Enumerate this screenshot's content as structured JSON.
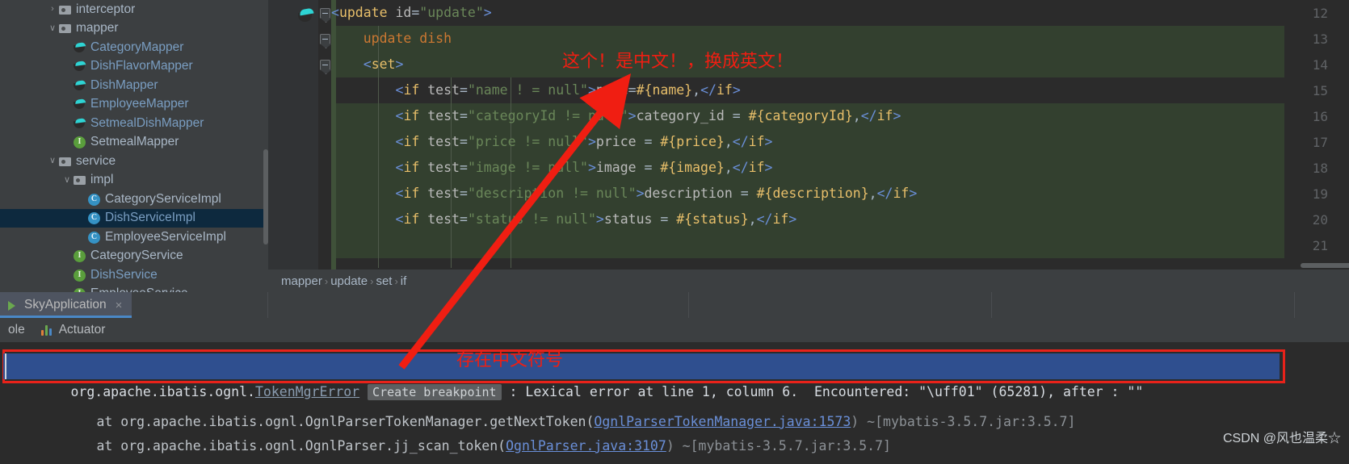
{
  "project_tree": {
    "items": [
      {
        "label": "interceptor",
        "icon": "folder-icon",
        "indent": 0,
        "arrow": "›",
        "selected": false,
        "blue": false
      },
      {
        "label": "mapper",
        "icon": "folder-icon",
        "indent": 0,
        "arrow": "∨",
        "selected": false,
        "blue": false
      },
      {
        "label": "CategoryMapper",
        "icon": "mybatis-icon",
        "indent": 1,
        "arrow": "",
        "selected": false,
        "blue": true
      },
      {
        "label": "DishFlavorMapper",
        "icon": "mybatis-icon",
        "indent": 1,
        "arrow": "",
        "selected": false,
        "blue": true
      },
      {
        "label": "DishMapper",
        "icon": "mybatis-icon",
        "indent": 1,
        "arrow": "",
        "selected": false,
        "blue": true
      },
      {
        "label": "EmployeeMapper",
        "icon": "mybatis-icon",
        "indent": 1,
        "arrow": "",
        "selected": false,
        "blue": true
      },
      {
        "label": "SetmealDishMapper",
        "icon": "mybatis-icon",
        "indent": 1,
        "arrow": "",
        "selected": false,
        "blue": true
      },
      {
        "label": "SetmealMapper",
        "icon": "interface-icon",
        "indent": 1,
        "arrow": "",
        "selected": false,
        "blue": false
      },
      {
        "label": "service",
        "icon": "folder-icon",
        "indent": 0,
        "arrow": "∨",
        "selected": false,
        "blue": false
      },
      {
        "label": "impl",
        "icon": "folder-icon",
        "indent": 1,
        "arrow": "∨",
        "selected": false,
        "blue": false
      },
      {
        "label": "CategoryServiceImpl",
        "icon": "class-icon",
        "indent": 2,
        "arrow": "",
        "selected": false,
        "blue": false
      },
      {
        "label": "DishServiceImpl",
        "icon": "class-icon",
        "indent": 2,
        "arrow": "",
        "selected": true,
        "blue": true
      },
      {
        "label": "EmployeeServiceImpl",
        "icon": "class-icon",
        "indent": 2,
        "arrow": "",
        "selected": false,
        "blue": false
      },
      {
        "label": "CategoryService",
        "icon": "interface-icon",
        "indent": 1,
        "arrow": "",
        "selected": false,
        "blue": false
      },
      {
        "label": "DishService",
        "icon": "interface-icon",
        "indent": 1,
        "arrow": "",
        "selected": false,
        "blue": true
      },
      {
        "label": "EmployeeService",
        "icon": "interface-icon",
        "indent": 1,
        "arrow": "",
        "selected": false,
        "blue": false
      }
    ]
  },
  "editor": {
    "line_numbers": [
      "12",
      "13",
      "14",
      "15",
      "16",
      "17",
      "18",
      "19",
      "20",
      "21"
    ],
    "lines": [
      {
        "n": "12",
        "text": "<update id=\"update\">"
      },
      {
        "n": "13",
        "text": "    update dish"
      },
      {
        "n": "14",
        "text": "    <set>"
      },
      {
        "n": "15",
        "text": "        <if test=\"name ! = null\">name=#{name},</if>"
      },
      {
        "n": "16",
        "text": "        <if test=\"categoryId != null\">category_id = #{categoryId},</if>"
      },
      {
        "n": "17",
        "text": "        <if test=\"price != null\">price = #{price},</if>"
      },
      {
        "n": "18",
        "text": "        <if test=\"image != null\">image = #{image},</if>"
      },
      {
        "n": "19",
        "text": "        <if test=\"description != null\">description = #{description},</if>"
      },
      {
        "n": "20",
        "text": "        <if test=\"status != null\">status = #{status},</if>"
      },
      {
        "n": "21",
        "text": ""
      }
    ]
  },
  "breadcrumb": {
    "items": [
      "mapper",
      "update",
      "set",
      "if"
    ],
    "separator": "›"
  },
  "run_window": {
    "tab_label": "SkyApplication",
    "tab_close": "×",
    "toolbar": {
      "console_label": "ole",
      "actuator_label": "Actuator"
    },
    "console": {
      "error_prefix": "org.apache.ibatis.ognl.",
      "error_link": "TokenMgrError",
      "breakpoint_chip": "Create breakpoint",
      "error_rest": " : Lexical error at line 1, column 6.  Encountered: \"\\uff01\" (65281), after : \"\"",
      "stack": [
        {
          "prefix": "at org.apache.ibatis.ognl.OgnlParserTokenManager.getNextToken(",
          "link": "OgnlParserTokenManager.java:1573",
          "suffix": ") ~[mybatis-3.5.7.jar:3.5.7]"
        },
        {
          "prefix": "at org.apache.ibatis.ognl.OgnlParser.jj_scan_token(",
          "link": "OgnlParser.java:3107",
          "suffix": ") ~[mybatis-3.5.7.jar:3.5.7]"
        }
      ]
    }
  },
  "annotations": {
    "top_note": "这个！是中文！，换成英文！",
    "bottom_note": "存在中文符号",
    "color": "#f01e12"
  },
  "watermark": {
    "text": "CSDN @风也温柔☆"
  }
}
